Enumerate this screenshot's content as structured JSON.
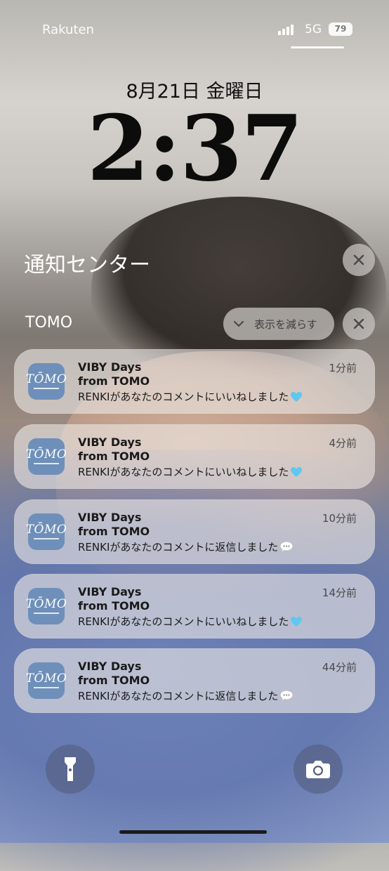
{
  "status_bar": {
    "carrier": "Rakuten",
    "network": "5G",
    "battery": "79"
  },
  "lock": {
    "date": "8月21日 金曜日",
    "time": "2:37"
  },
  "notification_center": {
    "title": "通知センター"
  },
  "group": {
    "app_name": "TOMO",
    "show_less": "表示を減らす"
  },
  "notifications": [
    {
      "title": "VIBY Days",
      "subtitle": "from TOMO",
      "message": "RENKIがあなたのコメントにいいねしました",
      "emoji": "blue-heart-icon",
      "time": "1分前"
    },
    {
      "title": "VIBY Days",
      "subtitle": "from TOMO",
      "message": "RENKIがあなたのコメントにいいねしました",
      "emoji": "blue-heart-icon",
      "time": "4分前"
    },
    {
      "title": "VIBY Days",
      "subtitle": "from TOMO",
      "message": "RENKIがあなたのコメントに返信しました",
      "emoji": "speech-bubble-icon",
      "time": "10分前"
    },
    {
      "title": "VIBY Days",
      "subtitle": "from TOMO",
      "message": "RENKIがあなたのコメントにいいねしました",
      "emoji": "blue-heart-icon",
      "time": "14分前"
    },
    {
      "title": "VIBY Days",
      "subtitle": "from TOMO",
      "message": "RENKIがあなたのコメントに返信しました",
      "emoji": "speech-bubble-icon",
      "time": "44分前"
    }
  ],
  "app_icon": {
    "logo_text": "TŌMO"
  },
  "colors": {
    "heart": "#5ec8f0",
    "app_icon_bg": "#6e8fb9"
  },
  "bottom": {
    "left": "flashlight-icon",
    "right": "camera-icon"
  }
}
